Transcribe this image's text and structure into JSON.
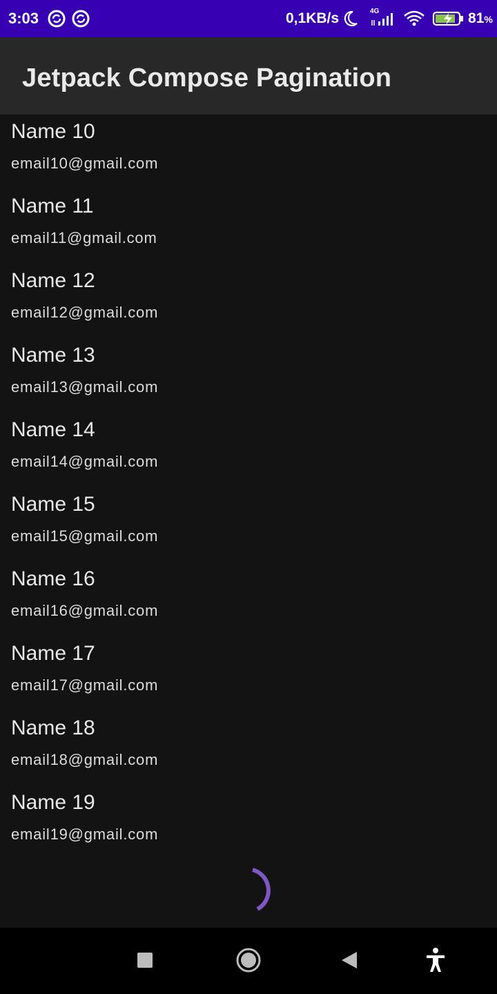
{
  "status_bar": {
    "time": "3:03",
    "network_speed": "0,1KB/s",
    "network_type": "4G",
    "battery": "81",
    "battery_unit": "%",
    "icons": [
      "sync-icon",
      "sync-icon",
      "moon-icon",
      "signal-icon",
      "wifi-icon",
      "battery-charging-icon"
    ],
    "color": "#3700b3"
  },
  "app_bar": {
    "title": "Jetpack Compose Pagination",
    "color": "#282829"
  },
  "items": [
    {
      "name": "Name 10",
      "email": "email10@gmail.com"
    },
    {
      "name": "Name 11",
      "email": "email11@gmail.com"
    },
    {
      "name": "Name 12",
      "email": "email12@gmail.com"
    },
    {
      "name": "Name 13",
      "email": "email13@gmail.com"
    },
    {
      "name": "Name 14",
      "email": "email14@gmail.com"
    },
    {
      "name": "Name 15",
      "email": "email15@gmail.com"
    },
    {
      "name": "Name 16",
      "email": "email16@gmail.com"
    },
    {
      "name": "Name 17",
      "email": "email17@gmail.com"
    },
    {
      "name": "Name 18",
      "email": "email18@gmail.com"
    },
    {
      "name": "Name 19",
      "email": "email19@gmail.com"
    }
  ],
  "loading": {
    "icon": "loading-spinner-icon",
    "color": "#7e57c2"
  },
  "nav_bar": {
    "icons": [
      "recents-square-icon",
      "home-circle-icon",
      "back-triangle-icon",
      "accessibility-icon"
    ]
  }
}
